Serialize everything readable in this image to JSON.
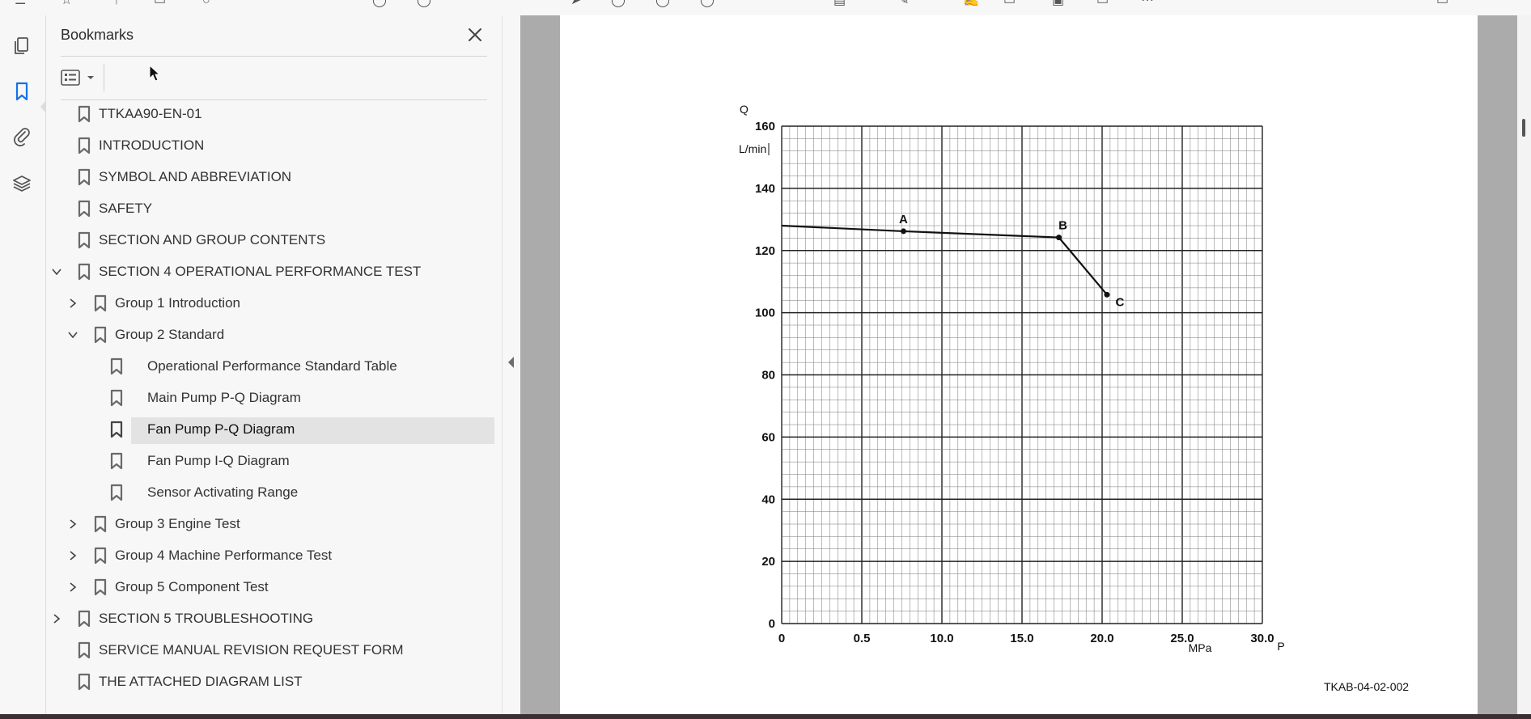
{
  "panel": {
    "title": "Bookmarks"
  },
  "bookmarks": [
    {
      "label": "TTKAA90-EN-01",
      "level": 0,
      "expander": "none",
      "selected": false
    },
    {
      "label": "INTRODUCTION",
      "level": 0,
      "expander": "none",
      "selected": false
    },
    {
      "label": "SYMBOL AND ABBREVIATION",
      "level": 0,
      "expander": "none",
      "selected": false
    },
    {
      "label": "SAFETY",
      "level": 0,
      "expander": "none",
      "selected": false
    },
    {
      "label": "SECTION AND GROUP CONTENTS",
      "level": 0,
      "expander": "none",
      "selected": false
    },
    {
      "label": "SECTION 4 OPERATIONAL PERFORMANCE TEST",
      "level": 0,
      "expander": "expanded",
      "selected": false
    },
    {
      "label": "Group 1 Introduction",
      "level": 1,
      "expander": "collapsed",
      "selected": false
    },
    {
      "label": "Group 2 Standard",
      "level": 1,
      "expander": "expanded",
      "selected": false
    },
    {
      "label": "Operational Performance Standard Table",
      "level": 2,
      "expander": "none",
      "selected": false
    },
    {
      "label": "Main Pump P-Q Diagram",
      "level": 2,
      "expander": "none",
      "selected": false
    },
    {
      "label": "Fan Pump P-Q Diagram",
      "level": 2,
      "expander": "none",
      "selected": true
    },
    {
      "label": "Fan Pump I-Q Diagram",
      "level": 2,
      "expander": "none",
      "selected": false
    },
    {
      "label": "Sensor Activating Range",
      "level": 2,
      "expander": "none",
      "selected": false
    },
    {
      "label": "Group 3 Engine Test",
      "level": 1,
      "expander": "collapsed",
      "selected": false
    },
    {
      "label": "Group 4 Machine Performance Test",
      "level": 1,
      "expander": "collapsed",
      "selected": false
    },
    {
      "label": "Group 5 Component Test",
      "level": 1,
      "expander": "collapsed",
      "selected": false
    },
    {
      "label": "SECTION 5 TROUBLESHOOTING",
      "level": 0,
      "expander": "collapsed",
      "selected": false
    },
    {
      "label": "SERVICE MANUAL REVISION REQUEST FORM",
      "level": 0,
      "expander": "none",
      "selected": false
    },
    {
      "label": "THE ATTACHED DIAGRAM LIST",
      "level": 0,
      "expander": "none",
      "selected": false
    }
  ],
  "rail": {
    "icons": [
      "pages-icon",
      "bookmark-icon",
      "attachment-icon",
      "layers-icon"
    ],
    "active": "bookmark-icon",
    "accent": "#1473e6"
  },
  "document": {
    "doc_id": "TKAB-04-02-002"
  },
  "chart_data": {
    "type": "line",
    "y_symbol": "Q",
    "y_unit": "L/min",
    "x_symbol": "P",
    "x_unit": "MPa",
    "x_ticks": [
      "0",
      "0.5",
      "10.0",
      "15.0",
      "20.0",
      "25.0",
      "30.0"
    ],
    "y_ticks": [
      "0",
      "20",
      "40",
      "60",
      "80",
      "100",
      "120",
      "140",
      "160"
    ],
    "xlim": [
      0,
      30
    ],
    "ylim": [
      0,
      160
    ],
    "grid": true,
    "series": [
      {
        "x": [
          0,
          7.6,
          17.3,
          20.3
        ],
        "y": [
          128,
          126.2,
          124.2,
          105.8
        ]
      }
    ],
    "points": [
      {
        "label": "A",
        "x": 7.6,
        "y": 126.2
      },
      {
        "label": "B",
        "x": 17.3,
        "y": 124.2
      },
      {
        "label": "C",
        "x": 20.3,
        "y": 105.8
      }
    ]
  }
}
